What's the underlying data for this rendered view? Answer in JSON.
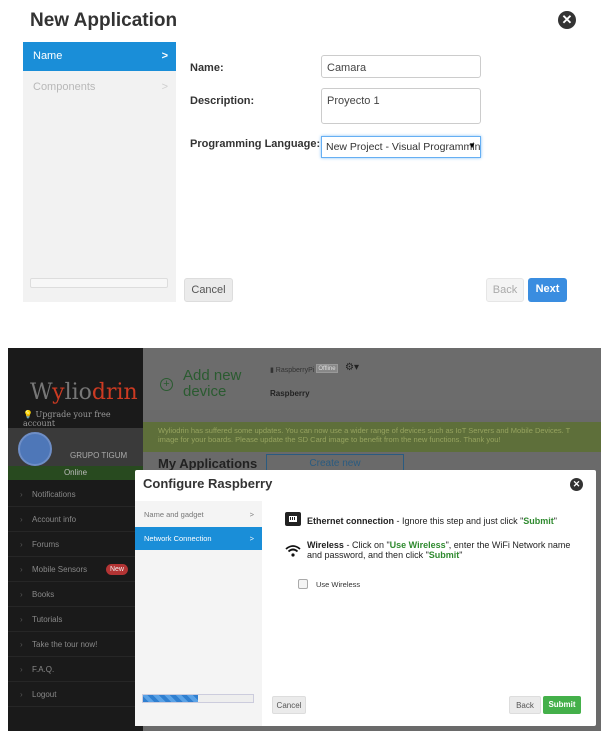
{
  "new_app": {
    "title": "New Application",
    "close_icon": "close-circle-icon",
    "sidebar": [
      {
        "label": "Name",
        "chevron": ">",
        "active": true
      },
      {
        "label": "Components",
        "chevron": ">",
        "active": false
      }
    ],
    "fields": {
      "name_label": "Name:",
      "name_value": "Camara",
      "description_label": "Description:",
      "description_value": "Proyecto 1",
      "language_label": "Programming Language:",
      "language_value": "New Project - Visual Programming"
    },
    "buttons": {
      "cancel": "Cancel",
      "back": "Back",
      "next": "Next"
    }
  },
  "wyliodrin": {
    "logo_prefix": "W",
    "logo_y": "y",
    "logo_rest": "lio",
    "logo_accent": "drin",
    "upgrade": "Upgrade your free account",
    "group": "GRUPO TIGUM",
    "status": "Online",
    "nav": [
      {
        "label": "Notifications"
      },
      {
        "label": "Account info"
      },
      {
        "label": "Forums"
      },
      {
        "label": "Mobile Sensors",
        "badge": "New"
      },
      {
        "label": "Books"
      },
      {
        "label": "Tutorials"
      },
      {
        "label": "Take the tour now!"
      },
      {
        "label": "F.A.Q."
      },
      {
        "label": "Logout"
      }
    ],
    "header": {
      "add_new_line1": "Add new",
      "add_new_line2": "device",
      "device_name": "RaspberryPi",
      "device_status": "Offline",
      "device_board": "Raspberry"
    },
    "update_notice": "Wyliodrin has suffered some updates. You can now use a wider range of devices such as IoT Servers and Mobile Devices. T image for your boards. Please update the SD Card image to benefit from the new functions. Thank you!",
    "my_apps": "My Applications",
    "create_new": "Create new",
    "modal": {
      "title": "Configure Raspberry",
      "sidebar": [
        {
          "label": "Name and gadget",
          "chevron": ">",
          "active": false
        },
        {
          "label": "Network Connection",
          "chevron": ">",
          "active": true
        }
      ],
      "progress": 0.5,
      "ethernet_title": "Ethernet connection",
      "ethernet_text": " - Ignore this step and just click \"",
      "ethernet_submit": "Submit",
      "ethernet_end": "\"",
      "wireless_title": "Wireless",
      "wireless_text1": " - Click on \"",
      "wireless_use": "Use Wireless",
      "wireless_text2": "\", enter the WiFi Network name",
      "wireless_line2": "and password, and then click \"",
      "wireless_submit": "Submit",
      "wireless_end": "\"",
      "use_wireless_label": "Use Wireless",
      "buttons": {
        "cancel": "Cancel",
        "back": "Back",
        "submit": "Submit"
      }
    }
  },
  "colors": {
    "accent_blue": "#1a8ed8",
    "next_blue": "#3a8de0",
    "submit_green": "#44b04a",
    "logo_red": "#cc3a22"
  }
}
